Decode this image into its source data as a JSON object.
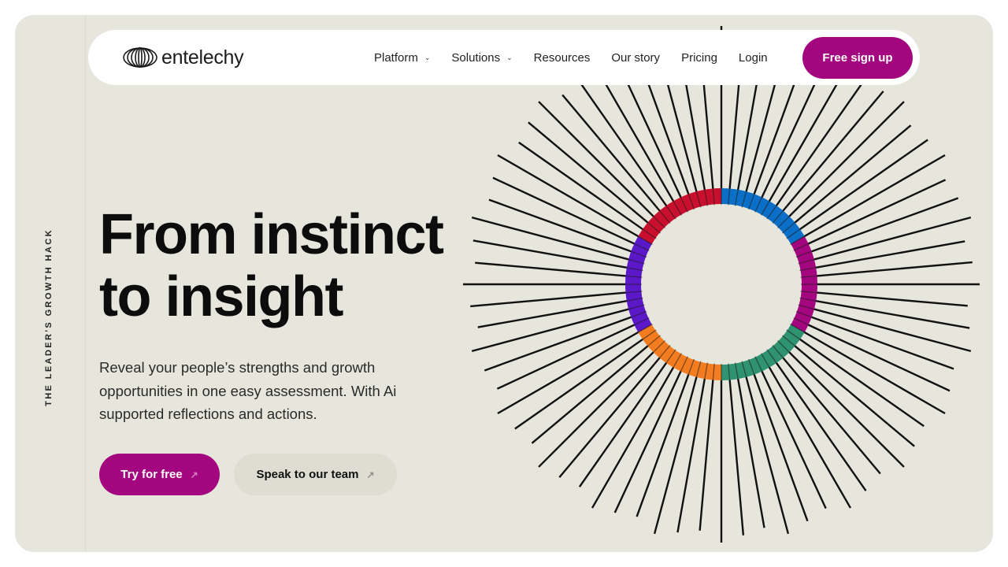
{
  "brand": {
    "name": "entelechy"
  },
  "side_tag": "THE LEADER'S GROWTH HACK",
  "nav": {
    "items": [
      {
        "label": "Platform",
        "dropdown": true
      },
      {
        "label": "Solutions",
        "dropdown": true
      },
      {
        "label": "Resources",
        "dropdown": false
      },
      {
        "label": "Our story",
        "dropdown": false
      },
      {
        "label": "Pricing",
        "dropdown": false
      },
      {
        "label": "Login",
        "dropdown": false
      }
    ],
    "cta": "Free sign up",
    "chevron": "⌄"
  },
  "hero": {
    "headline_line1": "From instinct",
    "headline_line2": "to insight",
    "subtext": "Reveal your people’s strengths and growth opportunities in one easy assessment. With Ai supported reflections and actions.",
    "primary_button": "Try for free",
    "secondary_button": "Speak to our team",
    "arrow": "↗"
  },
  "colors": {
    "background": "#e7e6dc",
    "accent": "#a4067f",
    "ring_segments": [
      "#0b6fc7",
      "#a4067f",
      "#2f9270",
      "#f47c20",
      "#5a18c8",
      "#c8102e"
    ]
  },
  "icons": [
    "entelechy-logo-icon",
    "chevron-down-icon",
    "arrow-up-right-icon",
    "sunburst-graphic"
  ]
}
